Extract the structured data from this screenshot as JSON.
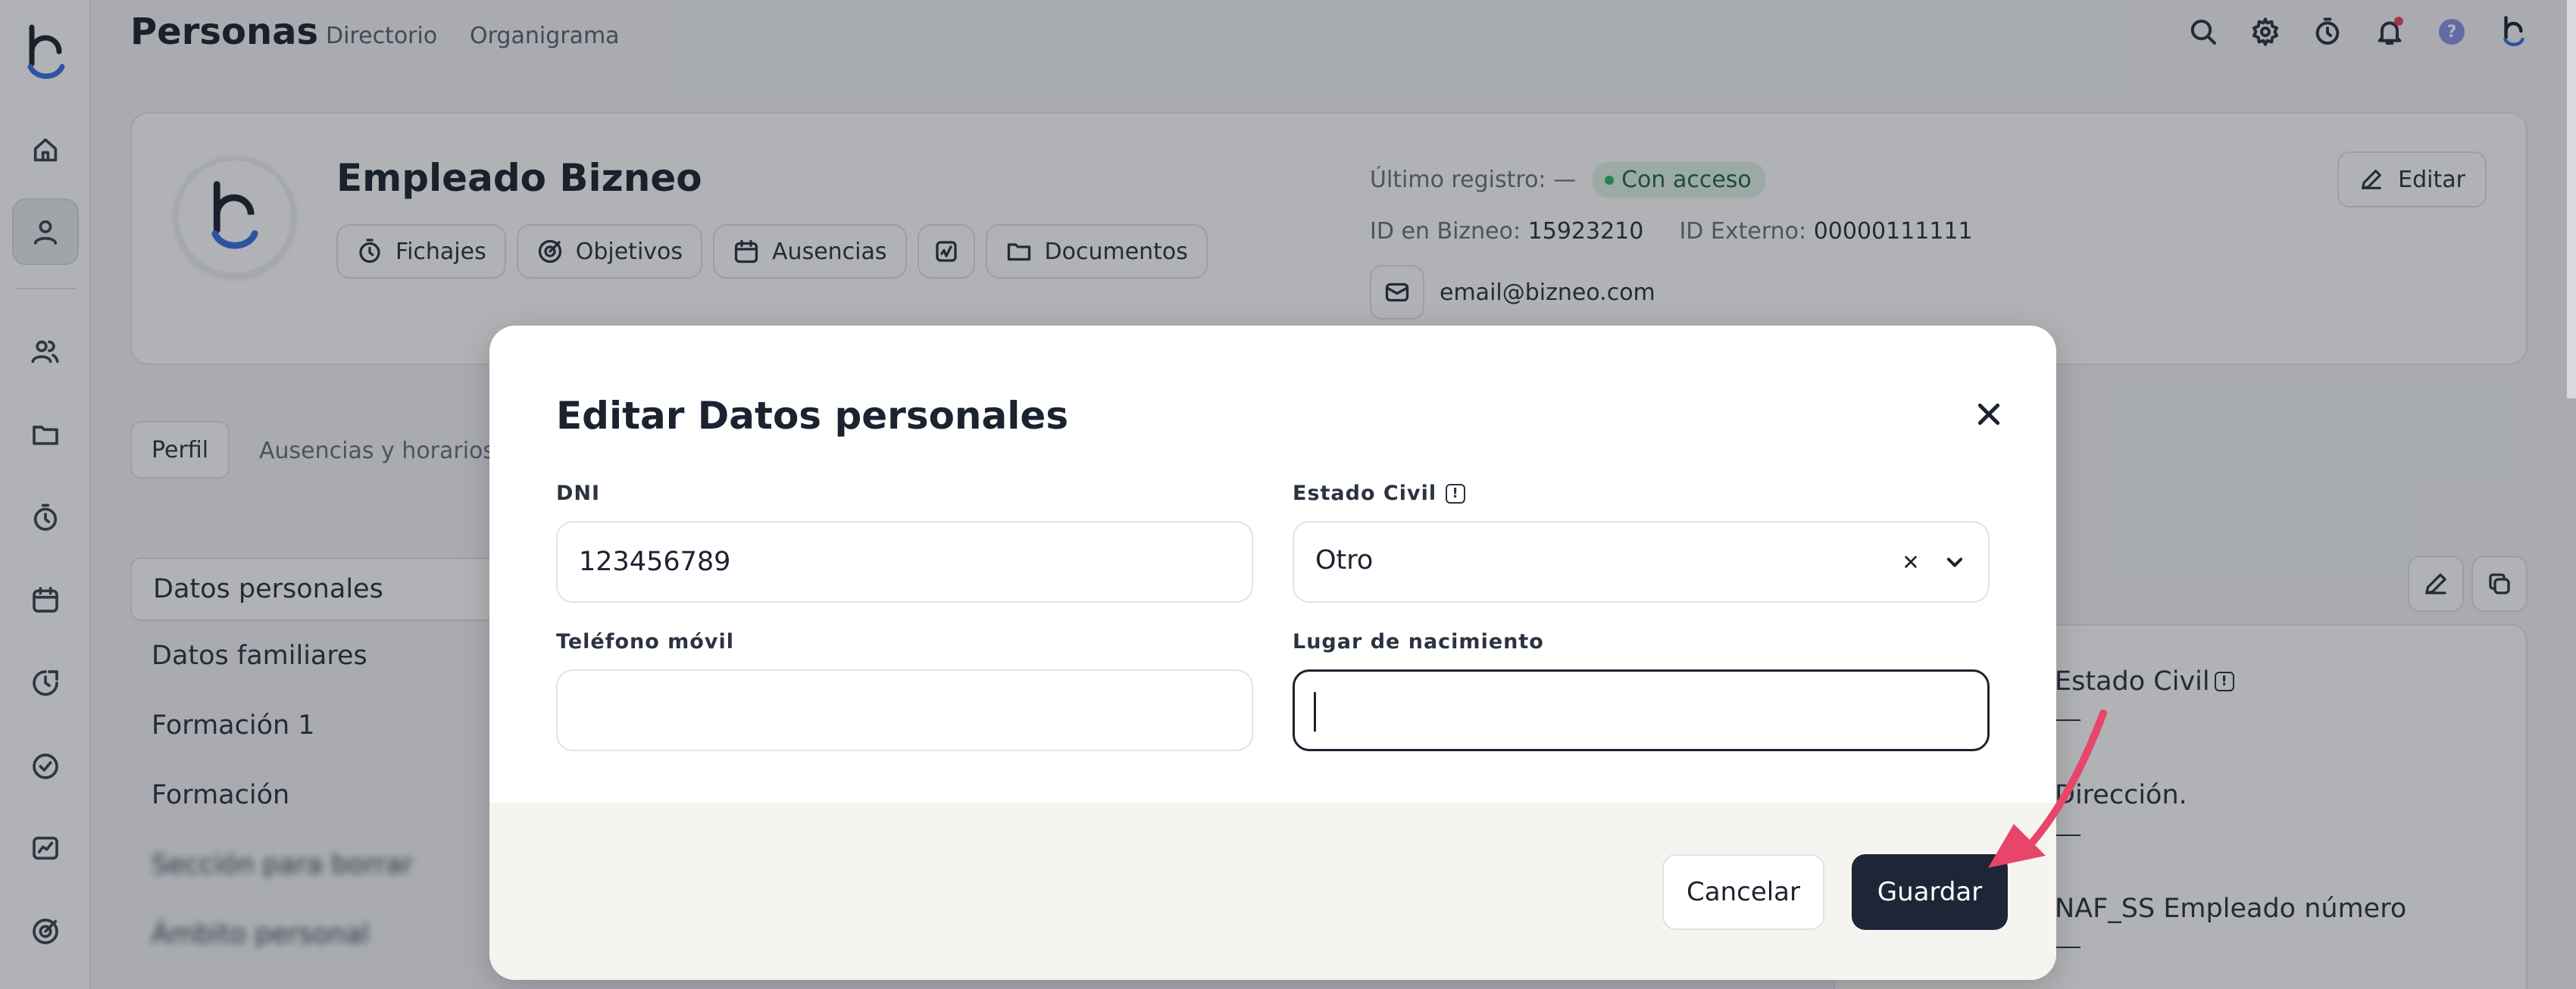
{
  "app": {
    "page_title": "Personas",
    "nav_links": [
      "Directorio",
      "Organigrama"
    ]
  },
  "sidebar": {
    "icons": [
      "bizneo-logo-icon",
      "home-icon",
      "person-icon",
      "people-icon",
      "folder-icon",
      "stopwatch-icon",
      "calendar-icon",
      "time-chart-icon",
      "check-circle-icon",
      "chart-icon",
      "target-icon"
    ],
    "active_item": "person-icon"
  },
  "top_icons": [
    "search-icon",
    "gear-icon",
    "stopwatch-icon",
    "bell-icon",
    "help-icon",
    "bizneo-logo-icon"
  ],
  "help_glyph": "?",
  "profile": {
    "name": "Empleado Bizneo",
    "pills": [
      {
        "label": "Fichajes",
        "icon": "stopwatch-icon"
      },
      {
        "label": "Objetivos",
        "icon": "target-icon"
      },
      {
        "label": "Ausencias",
        "icon": "calendar-icon"
      },
      {
        "label": "",
        "icon": "expense-icon"
      },
      {
        "label": "Documentos",
        "icon": "folder-icon"
      }
    ],
    "last_record_label": "Último registro: —",
    "access_badge": "Con acceso",
    "id_bizneo_label": "ID en Bizneo:",
    "id_bizneo_value": "15923210",
    "id_external_label": "ID Externo:",
    "id_external_value": "00000111111",
    "email": "email@bizneo.com",
    "edit_label": "Editar"
  },
  "tabs": {
    "active": "Perfil",
    "other": "Ausencias y horarios"
  },
  "left_menu": {
    "items": [
      "Datos personales",
      "Datos familiares",
      "Formación 1",
      "Formación"
    ],
    "blurred_items": [
      "Sección para borrar",
      "Ámbito personal"
    ]
  },
  "detail_fields": [
    {
      "label": "Estado Civil",
      "has_info": true,
      "value": "—"
    },
    {
      "label": "Dirección.",
      "has_info": false,
      "value": "—"
    },
    {
      "label": "NAF_SS Empleado número",
      "has_info": false,
      "value": "—"
    }
  ],
  "info_glyph": "!",
  "modal": {
    "title": "Editar Datos personales",
    "fields": {
      "dni": {
        "label": "DNI",
        "value": "123456789"
      },
      "estado_civil": {
        "label": "Estado Civil",
        "value": "Otro"
      },
      "telefono": {
        "label": "Teléfono móvil",
        "value": ""
      },
      "lugar": {
        "label": "Lugar de nacimiento",
        "value": ""
      }
    },
    "cancel_label": "Cancelar",
    "save_label": "Guardar"
  },
  "colors": {
    "primary_button": "#1d2636",
    "annotation_arrow": "#e8456a",
    "badge_bg": "#dff3e6",
    "badge_dot": "#2fb36a"
  }
}
